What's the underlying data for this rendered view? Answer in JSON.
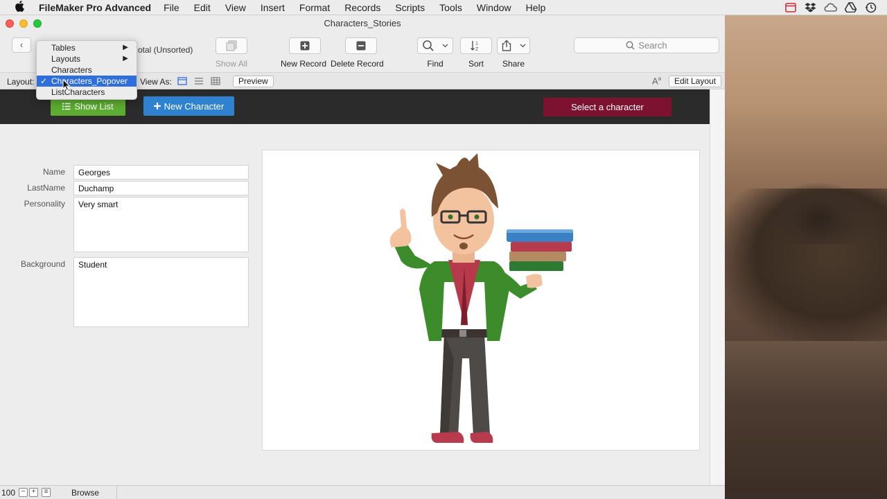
{
  "menubar": {
    "app_name": "FileMaker Pro Advanced",
    "items": [
      "File",
      "Edit",
      "View",
      "Insert",
      "Format",
      "Records",
      "Scripts",
      "Tools",
      "Window",
      "Help"
    ]
  },
  "window": {
    "title": "Characters_Stories"
  },
  "toolbar": {
    "total_text": "otal (Unsorted)",
    "show_all": "Show All",
    "new_record": "New Record",
    "delete_record": "Delete Record",
    "find": "Find",
    "sort": "Sort",
    "share": "Share",
    "search_placeholder": "Search"
  },
  "layoutbar": {
    "layout_label": "Layout:",
    "view_as_label": "View As:",
    "preview": "Preview",
    "edit_layout": "Edit Layout"
  },
  "dropdown": {
    "items": [
      {
        "label": "Tables",
        "submenu": true,
        "selected": false
      },
      {
        "label": "Layouts",
        "submenu": true,
        "selected": false
      },
      {
        "label": "Characters",
        "submenu": false,
        "selected": false
      },
      {
        "label": "Characters_Popover",
        "submenu": false,
        "selected": true
      },
      {
        "label": "ListCharacters",
        "submenu": false,
        "selected": false
      }
    ],
    "check": "✓"
  },
  "header": {
    "show_list": "Show List",
    "new_character": "New Character",
    "select_character": "Select a character"
  },
  "form": {
    "name_label": "Name",
    "name_value": "Georges",
    "lastname_label": "LastName",
    "lastname_value": "Duchamp",
    "personality_label": "Personality",
    "personality_value": "Very smart",
    "background_label": "Background",
    "background_value": "Student"
  },
  "statusbar": {
    "zoom": "100",
    "mode": "Browse"
  },
  "colors": {
    "green_button": "#5dad32",
    "blue_button": "#2e82cf",
    "maroon_button": "#7d1230",
    "menu_selected": "#2f6fdc"
  }
}
